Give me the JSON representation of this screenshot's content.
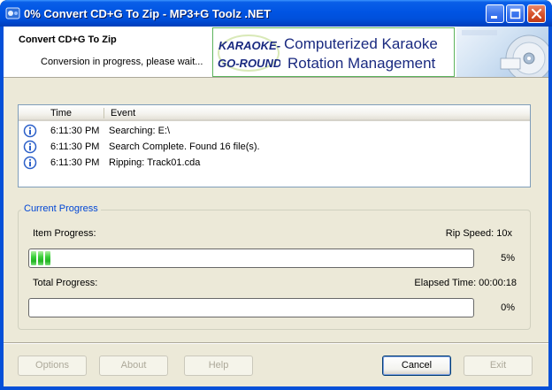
{
  "window": {
    "title": "0% Convert CD+G To Zip - MP3+G Toolz .NET"
  },
  "header": {
    "title": "Convert CD+G To Zip",
    "subtitle": "Conversion in progress, please wait...",
    "banner": {
      "logo_line1": "KARAOKE-",
      "logo_line2": "GO-ROUND",
      "line1": "Computerized Karaoke",
      "line2": "Rotation Management"
    }
  },
  "log": {
    "columns": [
      "Time",
      "Event"
    ],
    "rows": [
      {
        "time": "6:11:30 PM",
        "event": "Searching: E:\\"
      },
      {
        "time": "6:11:30 PM",
        "event": "Search Complete. Found 16 file(s)."
      },
      {
        "time": "6:11:30 PM",
        "event": "Ripping: Track01.cda"
      }
    ]
  },
  "progress": {
    "group_label": "Current Progress",
    "item_label": "Item Progress:",
    "rip_speed": "Rip Speed: 10x",
    "item_percent": "5%",
    "item_fraction": 0.05,
    "total_label": "Total Progress:",
    "elapsed": "Elapsed Time: 00:00:18",
    "total_percent": "0%",
    "total_fraction": 0
  },
  "buttons": {
    "options": "Options",
    "about": "About",
    "help": "Help",
    "cancel": "Cancel",
    "exit": "Exit"
  },
  "colors": {
    "titlebar": "#0054e3",
    "accent_label": "#0046d5",
    "progress_green": "#3cd13c",
    "banner_border": "#5bb35b"
  }
}
